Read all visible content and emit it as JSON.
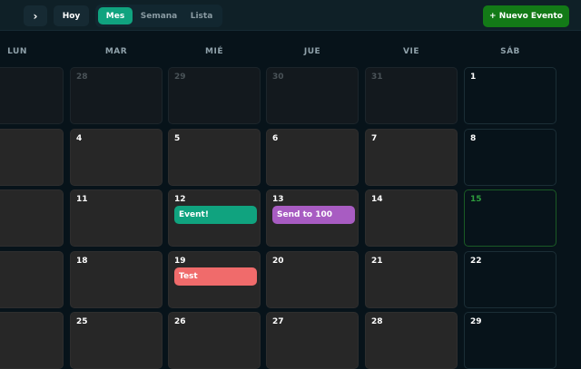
{
  "toolbar": {
    "next_icon": "›",
    "today_label": "Hoy",
    "views": [
      "Mes",
      "Semana",
      "Lista"
    ],
    "active_view": "Mes",
    "new_event_label": "+ Nuevo Evento"
  },
  "weekdays": [
    "LUN",
    "MAR",
    "MIÉ",
    "JUE",
    "VIE",
    "SÁB"
  ],
  "weeks": [
    [
      "",
      "28",
      "29",
      "30",
      "31",
      "1"
    ],
    [
      "",
      "4",
      "5",
      "6",
      "7",
      "8"
    ],
    [
      "",
      "11",
      "12",
      "13",
      "14",
      "15"
    ],
    [
      "",
      "18",
      "19",
      "20",
      "21",
      "22"
    ],
    [
      "",
      "25",
      "26",
      "27",
      "28",
      "29"
    ]
  ],
  "today": "15",
  "events": [
    {
      "day": "12",
      "title": "Event!",
      "color": "#10a37f"
    },
    {
      "day": "13",
      "title": "Send to 100",
      "color": "#a85cc2"
    },
    {
      "day": "19",
      "title": "Test",
      "color": "#f06b6b"
    }
  ],
  "colors": {
    "accent": "#10a37f",
    "new_event": "#137a17",
    "today_border": "#1a5a25",
    "background": "#07131a"
  }
}
